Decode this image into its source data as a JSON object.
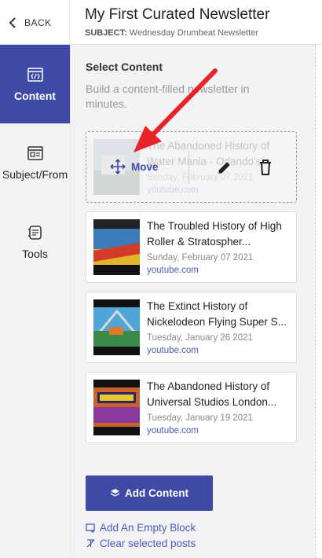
{
  "header": {
    "back_label": "BACK",
    "title": "My First Curated Newsletter",
    "subject_label": "SUBJECT:",
    "subject_value": "Wednesday Drumbeat Newsletter"
  },
  "sidebar": {
    "items": [
      {
        "label": "Content",
        "icon": "code-window-icon",
        "active": true
      },
      {
        "label": "Subject/From",
        "icon": "layout-icon",
        "active": false
      },
      {
        "label": "Tools",
        "icon": "tools-icon",
        "active": false
      }
    ]
  },
  "main": {
    "section_title": "Select Content",
    "section_desc": "Build a content-filled newsletter in minutes.",
    "drag_overlay": {
      "move_label": "Move",
      "edit_icon": "pencil-icon",
      "delete_icon": "trash-icon"
    },
    "posts": [
      {
        "title": "The Abandoned History of Water Mania - Orlando's...",
        "date": "Sunday, February 07 2021",
        "source": "youtube.com",
        "dragging": true
      },
      {
        "title": "The Troubled History of High Roller & Stratospher...",
        "date": "Sunday, February 07 2021",
        "source": "youtube.com",
        "dragging": false
      },
      {
        "title": "The Extinct History of Nickelodeon Flying Super S...",
        "date": "Tuesday, January 26 2021",
        "source": "youtube.com",
        "dragging": false
      },
      {
        "title": "The Abandoned History of Universal Studios London...",
        "date": "Tuesday, January 19 2021",
        "source": "youtube.com",
        "dragging": false
      }
    ],
    "add_button": "Add Content",
    "add_empty_block": "Add An Empty Block",
    "clear_selected": "Clear selected posts"
  },
  "colors": {
    "accent": "#3f4aa6",
    "link": "#4a5cc0",
    "arrow": "#e8232a"
  }
}
